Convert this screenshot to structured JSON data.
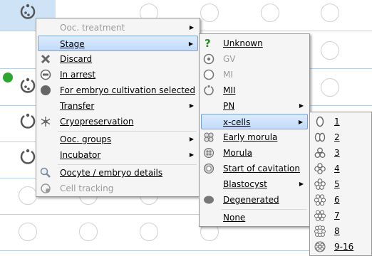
{
  "menu_main": {
    "items": [
      {
        "label": "Ooc. treatment",
        "disabled": true,
        "submenu": true,
        "icon": ""
      },
      {
        "label": "Stage",
        "highlighted": true,
        "submenu": true,
        "icon": ""
      },
      {
        "label": "Discard",
        "icon": "x-icon"
      },
      {
        "label": "In arrest",
        "icon": "minus-circle-icon"
      },
      {
        "label": "For embryo cultivation selected",
        "icon": "filled-circle-icon"
      },
      {
        "label": "Transfer",
        "submenu": true,
        "icon": ""
      },
      {
        "label": "Cryopreservation",
        "icon": "snowflake-icon"
      },
      {
        "label": "Ooc. groups",
        "submenu": true,
        "icon": ""
      },
      {
        "label": "Incubator",
        "submenu": true,
        "icon": ""
      },
      {
        "label": "Oocyte / embryo details",
        "icon": "magnifier-icon"
      },
      {
        "label": "Cell tracking",
        "disabled": true,
        "icon": "cell-tracking-icon"
      }
    ]
  },
  "menu_stage": {
    "items": [
      {
        "label": "Unknown",
        "icon": "question-icon",
        "color": "#2b8a2b"
      },
      {
        "label": "GV",
        "disabled": true,
        "icon": "gv-icon"
      },
      {
        "label": "MI",
        "disabled": true,
        "icon": "mi-icon"
      },
      {
        "label": "MII",
        "icon": "mii-icon"
      },
      {
        "label": "PN",
        "submenu": true,
        "icon": ""
      },
      {
        "label": "x-cells",
        "highlighted": true,
        "submenu": true,
        "icon": ""
      },
      {
        "label": "Early morula",
        "icon": "early-morula-icon"
      },
      {
        "label": "Morula",
        "icon": "morula-icon"
      },
      {
        "label": "Start of cavitation",
        "icon": "cavitation-icon"
      },
      {
        "label": "Blastocyst",
        "submenu": true,
        "icon": ""
      },
      {
        "label": "Degenerated",
        "icon": "degenerated-icon"
      },
      {
        "label": "None",
        "icon": ""
      }
    ]
  },
  "menu_cells": {
    "items": [
      {
        "label": "1",
        "icon": "cell-1-icon"
      },
      {
        "label": "2",
        "icon": "cell-2-icon"
      },
      {
        "label": "3",
        "icon": "cell-3-icon"
      },
      {
        "label": "4",
        "icon": "cell-4-icon"
      },
      {
        "label": "5",
        "icon": "cell-5-icon"
      },
      {
        "label": "6",
        "icon": "cell-6-icon"
      },
      {
        "label": "7",
        "icon": "cell-7-icon"
      },
      {
        "label": "8",
        "icon": "cell-8-icon"
      },
      {
        "label": "9-16",
        "icon": "cell-9-16-icon"
      }
    ]
  },
  "colors": {
    "highlight": "#c1dbfb",
    "grid_line": "#b4cfe6",
    "selected_well": "#cfe3f7",
    "status_green": "#2ea52e"
  }
}
